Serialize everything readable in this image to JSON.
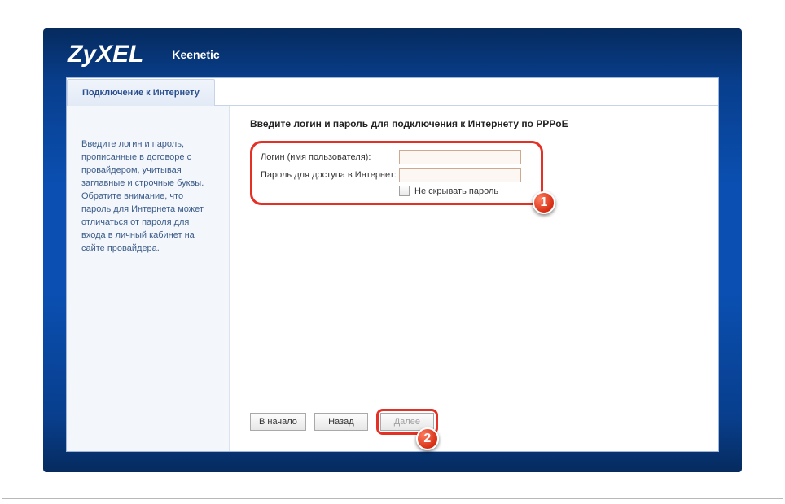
{
  "brand": {
    "logo": "ZyXEL",
    "model": "Keenetic"
  },
  "tab": {
    "label": "Подключение к Интернету"
  },
  "sidebar": {
    "help": "Введите логин и пароль, прописанные в договоре с провайдером, учитывая заглавные и строчные буквы. Обратите внимание, что пароль для Интернета может отличаться от пароля для входа в личный кабинет на сайте провайдера."
  },
  "main": {
    "heading": "Введите логин и пароль для подключения к Интернету по PPPoE",
    "login_label": "Логин (имя пользователя):",
    "password_label": "Пароль для доступа в Интернет:",
    "login_value": "",
    "password_value": "",
    "show_password_label": "Не скрывать пароль"
  },
  "buttons": {
    "home": "В начало",
    "back": "Назад",
    "next": "Далее"
  },
  "callouts": {
    "one": "1",
    "two": "2"
  }
}
